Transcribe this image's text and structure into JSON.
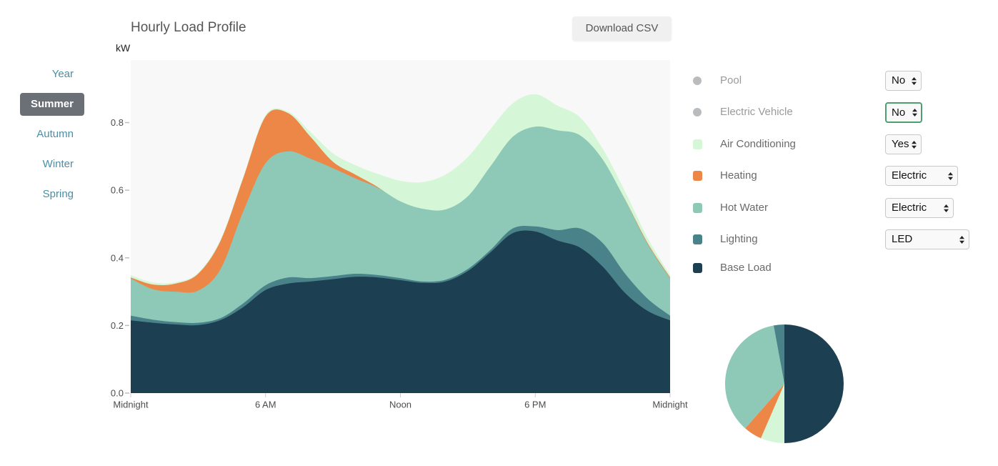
{
  "sidebar": {
    "items": [
      {
        "label": "Year",
        "active": false
      },
      {
        "label": "Summer",
        "active": true
      },
      {
        "label": "Autumn",
        "active": false
      },
      {
        "label": "Winter",
        "active": false
      },
      {
        "label": "Spring",
        "active": false
      }
    ]
  },
  "header": {
    "title": "Hourly Load Profile",
    "download_button": "Download CSV",
    "unit_label": "kW"
  },
  "theme": {
    "link_color": "#4b8ea5",
    "active_nav_background": "#6b6f76",
    "focus_border": "#4f9e72",
    "plot_background": "#f8f8f8"
  },
  "legend": {
    "items": [
      {
        "label": "Pool",
        "marker": "circle",
        "color": "#b8bcbf",
        "enabled": false,
        "select": {
          "value": "No",
          "focused": false
        }
      },
      {
        "label": "Electric Vehicle",
        "marker": "circle",
        "color": "#b8bcbf",
        "enabled": false,
        "select": {
          "value": "No",
          "focused": true
        }
      },
      {
        "label": "Air Conditioning",
        "marker": "square",
        "color": "#d5f7d7",
        "enabled": true,
        "select": {
          "value": "Yes",
          "focused": false
        }
      },
      {
        "label": "Heating",
        "marker": "square",
        "color": "#ec8748",
        "enabled": true,
        "select": {
          "value": "Electric",
          "focused": false
        }
      },
      {
        "label": "Hot Water",
        "marker": "square",
        "color": "#8dc9b6",
        "enabled": true,
        "select": {
          "value": "Electric",
          "focused": false
        }
      },
      {
        "label": "Lighting",
        "marker": "square",
        "color": "#4a8289",
        "enabled": true,
        "select": {
          "value": "LED",
          "focused": false
        }
      },
      {
        "label": "Base Load",
        "marker": "square",
        "color": "#1c3f51",
        "enabled": true,
        "select": null
      }
    ]
  },
  "chart_data": [
    {
      "type": "area",
      "stacked": true,
      "title": "Hourly Load Profile",
      "xlabel": "",
      "ylabel": "kW",
      "x": [
        0,
        1,
        2,
        3,
        4,
        5,
        6,
        7,
        8,
        9,
        10,
        11,
        12,
        13,
        14,
        15,
        16,
        17,
        18,
        19,
        20,
        21,
        22,
        23,
        24
      ],
      "xlim": [
        0,
        24
      ],
      "ylim": [
        0,
        0.985
      ],
      "x_ticks": [
        0,
        6,
        12,
        18,
        24
      ],
      "x_tick_labels": [
        "Midnight",
        "6 AM",
        "Noon",
        "6 PM",
        "Midnight"
      ],
      "y_ticks": [
        0,
        0.2,
        0.4,
        0.6,
        0.8
      ],
      "y_tick_labels": [
        "0.0",
        "0.2",
        "0.4",
        "0.6",
        "0.8"
      ],
      "grid": false,
      "legend": "right",
      "series": [
        {
          "name": "Base Load",
          "color": "#1c3f51",
          "values": [
            0.215,
            0.208,
            0.203,
            0.201,
            0.216,
            0.254,
            0.305,
            0.324,
            0.33,
            0.337,
            0.344,
            0.342,
            0.334,
            0.326,
            0.33,
            0.361,
            0.416,
            0.473,
            0.478,
            0.451,
            0.43,
            0.374,
            0.296,
            0.243,
            0.215
          ]
        },
        {
          "name": "Lighting",
          "color": "#4a8289",
          "values": [
            0.014,
            0.009,
            0.007,
            0.007,
            0.006,
            0.011,
            0.014,
            0.018,
            0.01,
            0.009,
            0.009,
            0.007,
            0.006,
            0.004,
            0.005,
            0.006,
            0.007,
            0.014,
            0.015,
            0.031,
            0.057,
            0.07,
            0.057,
            0.036,
            0.014
          ]
        },
        {
          "name": "Hot Water",
          "color": "#8dc9b6",
          "values": [
            0.11,
            0.09,
            0.09,
            0.095,
            0.145,
            0.271,
            0.361,
            0.373,
            0.353,
            0.319,
            0.282,
            0.258,
            0.227,
            0.215,
            0.208,
            0.215,
            0.247,
            0.271,
            0.295,
            0.295,
            0.275,
            0.247,
            0.218,
            0.162,
            0.11
          ]
        },
        {
          "name": "Heating",
          "color": "#ec8748",
          "values": [
            0.003,
            0.014,
            0.024,
            0.05,
            0.084,
            0.099,
            0.138,
            0.113,
            0.065,
            0.019,
            0.011,
            0.002,
            0,
            0,
            0,
            0,
            0,
            0,
            0,
            0,
            0,
            0,
            0.001,
            0.003,
            0.003
          ]
        },
        {
          "name": "Air Conditioning",
          "color": "#d5f7d7",
          "values": [
            0.007,
            0.006,
            0.004,
            0.003,
            0.004,
            0.003,
            0.004,
            0.004,
            0.014,
            0.025,
            0.028,
            0.039,
            0.061,
            0.079,
            0.103,
            0.116,
            0.11,
            0.099,
            0.096,
            0.073,
            0.053,
            0.032,
            0.024,
            0.015,
            0.007
          ]
        }
      ]
    },
    {
      "type": "pie",
      "title": "",
      "unit": "%",
      "start": "top",
      "direction": "clockwise",
      "slices": [
        {
          "label": "Base Load",
          "value": 50.0,
          "color": "#1c3f51"
        },
        {
          "label": "Air Conditioning",
          "value": 6.5,
          "color": "#d5f7d7"
        },
        {
          "label": "Heating",
          "value": 5.0,
          "color": "#ec8748"
        },
        {
          "label": "Hot Water",
          "value": 35.6,
          "color": "#8dc9b6"
        },
        {
          "label": "Lighting",
          "value": 2.9,
          "color": "#4a8289"
        }
      ]
    }
  ]
}
